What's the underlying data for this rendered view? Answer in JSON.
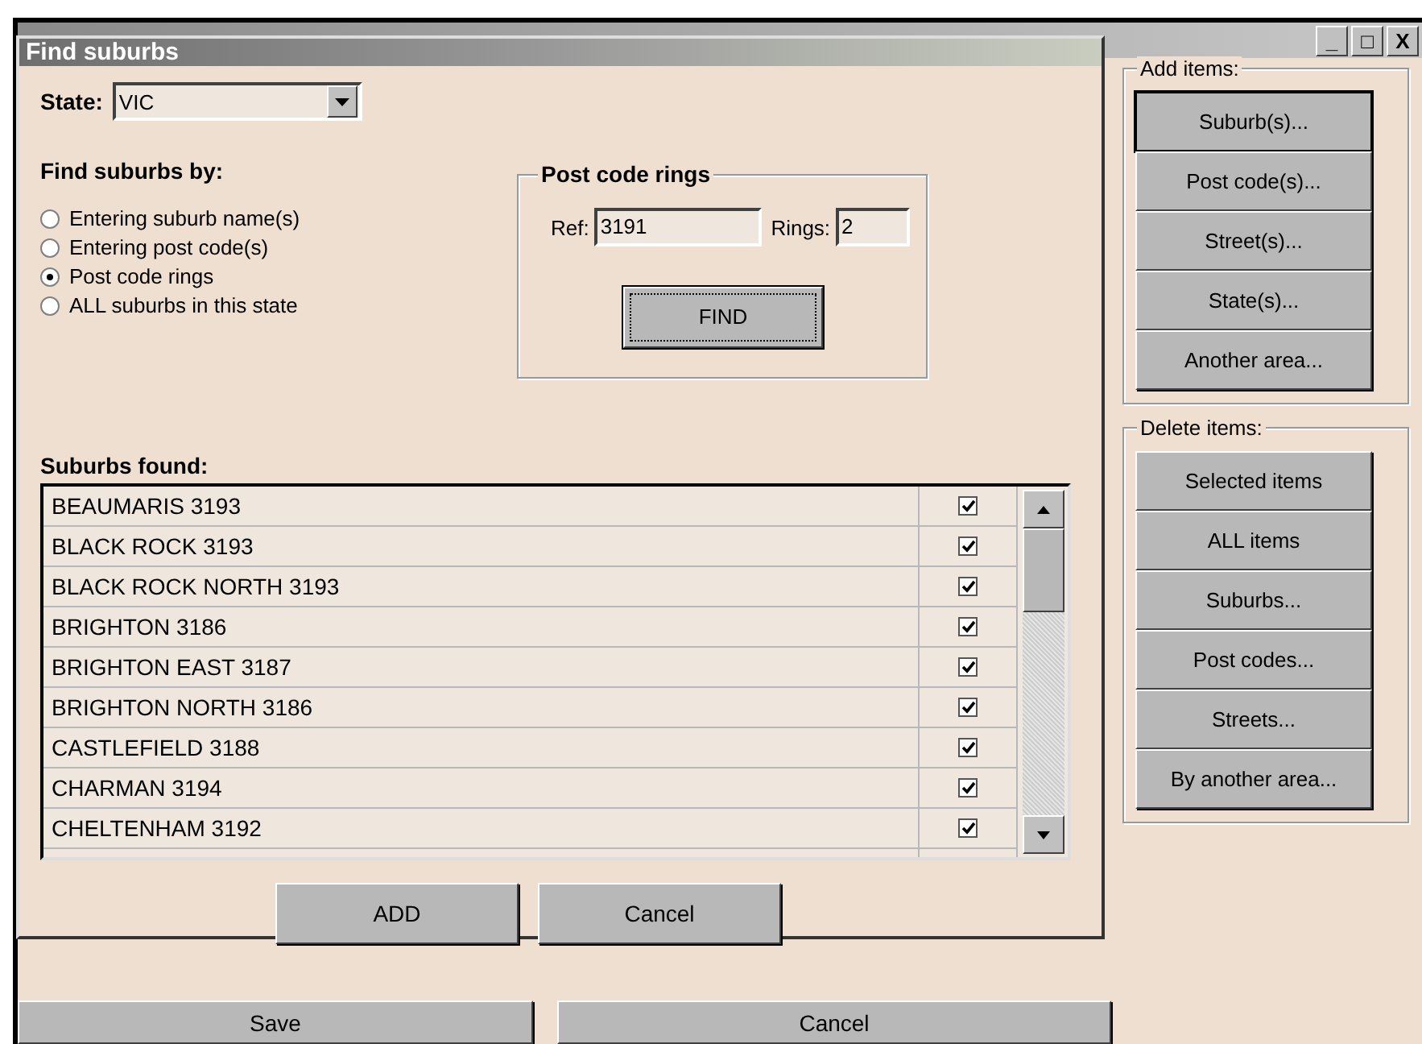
{
  "window": {
    "controls": [
      "_",
      "□",
      "X"
    ]
  },
  "side_panel": {
    "groups": [
      {
        "title": "Add items:",
        "buttons": [
          {
            "label": "Suburb(s)...",
            "focused": true
          },
          {
            "label": "Post code(s)...",
            "focused": false
          },
          {
            "label": "Street(s)...",
            "focused": false
          },
          {
            "label": "State(s)...",
            "focused": false
          },
          {
            "label": "Another area...",
            "focused": false
          }
        ]
      },
      {
        "title": "Delete items:",
        "buttons": [
          {
            "label": "Selected items",
            "focused": false
          },
          {
            "label": "ALL items",
            "focused": false
          },
          {
            "label": "Suburbs...",
            "focused": false
          },
          {
            "label": "Post codes...",
            "focused": false
          },
          {
            "label": "Streets...",
            "focused": false
          },
          {
            "label": "By another area...",
            "focused": false
          }
        ]
      }
    ]
  },
  "dialog": {
    "title": "Find suburbs",
    "state": {
      "label": "State:",
      "value": "VIC"
    },
    "find_by": {
      "label": "Find suburbs by:",
      "options": [
        {
          "label": "Entering suburb name(s)",
          "selected": false
        },
        {
          "label": "Entering post code(s)",
          "selected": false
        },
        {
          "label": "Post code rings",
          "selected": true
        },
        {
          "label": "ALL suburbs in this state",
          "selected": false
        }
      ]
    },
    "post_code_rings": {
      "title": "Post code rings",
      "ref_label": "Ref:",
      "ref_value": "3191",
      "rings_label": "Rings:",
      "rings_value": "2",
      "find_button": "FIND"
    },
    "suburbs_found": {
      "label": "Suburbs found:",
      "rows": [
        {
          "name": "BEAUMARIS 3193",
          "checked": true
        },
        {
          "name": "BLACK ROCK 3193",
          "checked": true
        },
        {
          "name": "BLACK ROCK NORTH 3193",
          "checked": true
        },
        {
          "name": "BRIGHTON 3186",
          "checked": true
        },
        {
          "name": "BRIGHTON EAST 3187",
          "checked": true
        },
        {
          "name": "BRIGHTON NORTH 3186",
          "checked": true
        },
        {
          "name": "CASTLEFIELD 3188",
          "checked": true
        },
        {
          "name": "CHARMAN 3194",
          "checked": true
        },
        {
          "name": "CHELTENHAM 3192",
          "checked": true
        }
      ]
    },
    "buttons": [
      "ADD",
      "Cancel"
    ]
  },
  "footer_buttons": [
    "Save",
    "Cancel"
  ]
}
